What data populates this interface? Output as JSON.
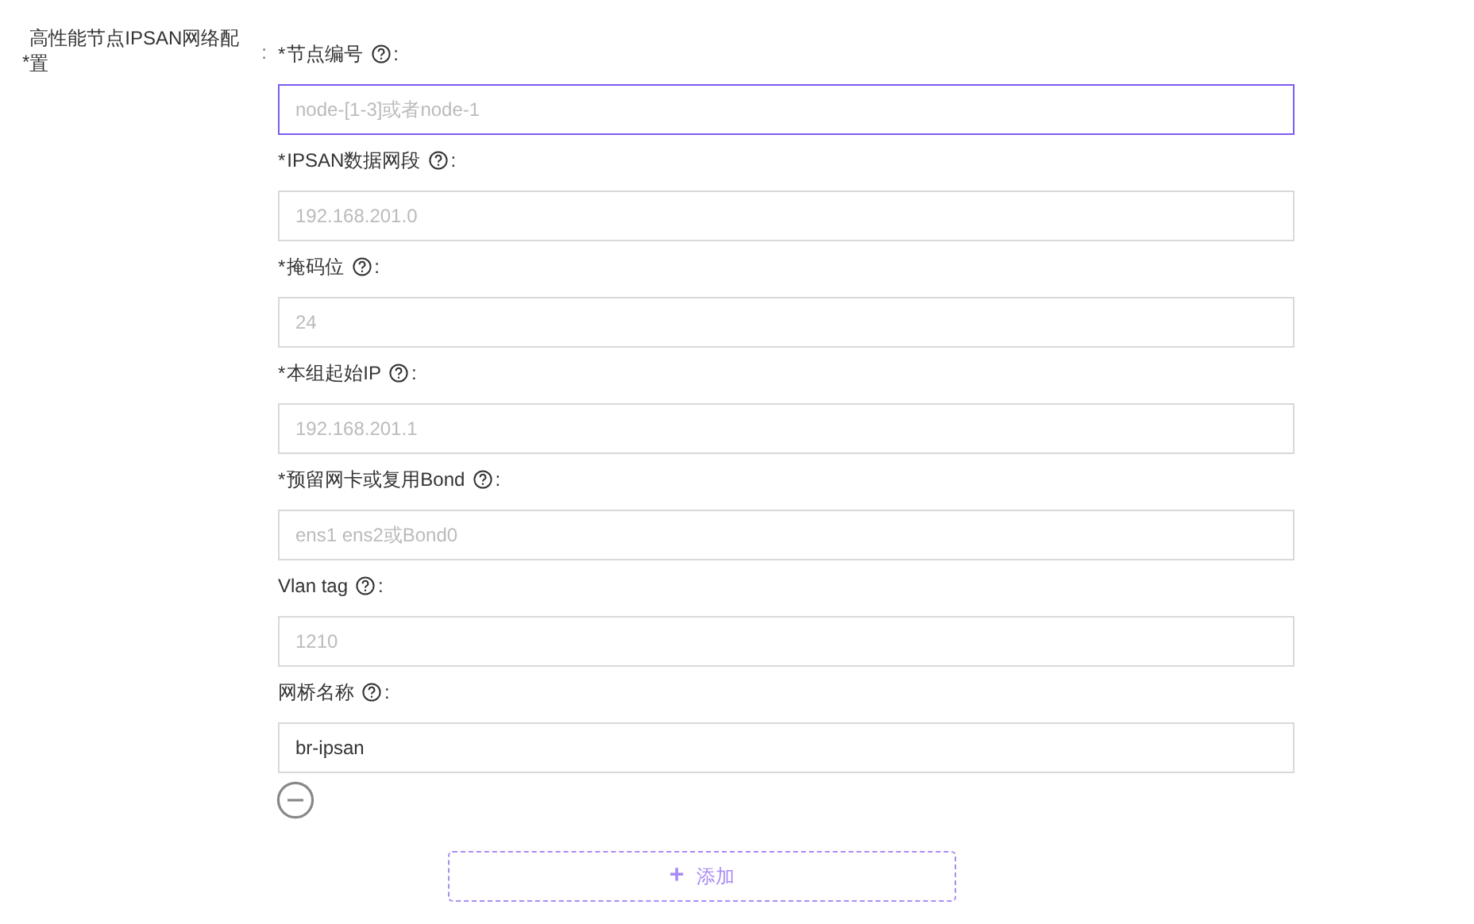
{
  "section": {
    "required_mark": "*",
    "label": "高性能节点IPSAN网络配置",
    "colon": ":"
  },
  "fields": [
    {
      "required_mark": "*",
      "label": "节点编号",
      "colon": ":",
      "placeholder": "node-[1-3]或者node-1",
      "focused": true
    },
    {
      "required_mark": "*",
      "label": "IPSAN数据网段",
      "colon": ":",
      "placeholder": "192.168.201.0",
      "focused": false
    },
    {
      "required_mark": "*",
      "label": "掩码位",
      "colon": ":",
      "placeholder": "24",
      "focused": false
    },
    {
      "required_mark": "*",
      "label": "本组起始IP",
      "colon": ":",
      "placeholder": "192.168.201.1",
      "focused": false
    },
    {
      "required_mark": "*",
      "label": "预留网卡或复用Bond",
      "colon": ":",
      "placeholder": "ens1 ens2或Bond0",
      "focused": false
    },
    {
      "label": "Vlan tag",
      "colon": ":",
      "placeholder": "1210",
      "focused": false
    },
    {
      "label": "网桥名称",
      "colon": ":",
      "value": "br-ipsan",
      "focused": false
    }
  ],
  "add_button": {
    "icon": "+",
    "label": "添加"
  }
}
